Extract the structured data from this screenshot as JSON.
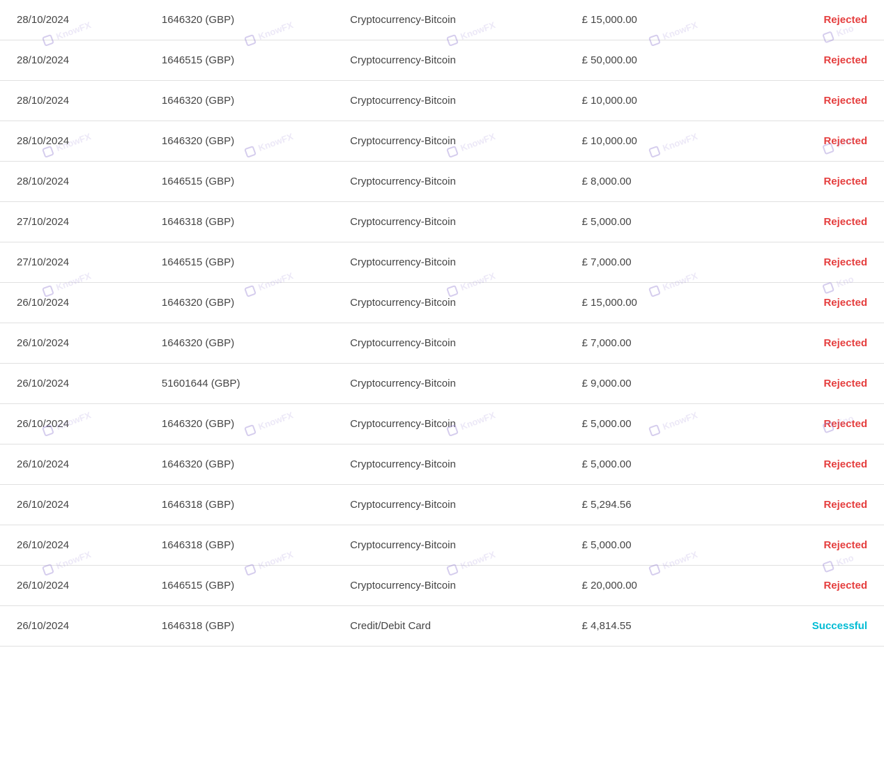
{
  "table": {
    "rows": [
      {
        "date": "28/10/2024",
        "account": "1646320 (GBP)",
        "method": "Cryptocurrency-Bitcoin",
        "amount": "£  15,000.00",
        "status": "Rejected",
        "status_type": "rejected"
      },
      {
        "date": "28/10/2024",
        "account": "1646515 (GBP)",
        "method": "Cryptocurrency-Bitcoin",
        "amount": "£  50,000.00",
        "status": "Rejected",
        "status_type": "rejected"
      },
      {
        "date": "28/10/2024",
        "account": "1646320 (GBP)",
        "method": "Cryptocurrency-Bitcoin",
        "amount": "£  10,000.00",
        "status": "Rejected",
        "status_type": "rejected"
      },
      {
        "date": "28/10/2024",
        "account": "1646320 (GBP)",
        "method": "Cryptocurrency-Bitcoin",
        "amount": "£  10,000.00",
        "status": "Rejected",
        "status_type": "rejected"
      },
      {
        "date": "28/10/2024",
        "account": "1646515 (GBP)",
        "method": "Cryptocurrency-Bitcoin",
        "amount": "£  8,000.00",
        "status": "Rejected",
        "status_type": "rejected"
      },
      {
        "date": "27/10/2024",
        "account": "1646318 (GBP)",
        "method": "Cryptocurrency-Bitcoin",
        "amount": "£  5,000.00",
        "status": "Rejected",
        "status_type": "rejected"
      },
      {
        "date": "27/10/2024",
        "account": "1646515 (GBP)",
        "method": "Cryptocurrency-Bitcoin",
        "amount": "£  7,000.00",
        "status": "Rejected",
        "status_type": "rejected"
      },
      {
        "date": "26/10/2024",
        "account": "1646320 (GBP)",
        "method": "Cryptocurrency-Bitcoin",
        "amount": "£  15,000.00",
        "status": "Rejected",
        "status_type": "rejected"
      },
      {
        "date": "26/10/2024",
        "account": "1646320 (GBP)",
        "method": "Cryptocurrency-Bitcoin",
        "amount": "£  7,000.00",
        "status": "Rejected",
        "status_type": "rejected"
      },
      {
        "date": "26/10/2024",
        "account": "51601644 (GBP)",
        "method": "Cryptocurrency-Bitcoin",
        "amount": "£  9,000.00",
        "status": "Rejected",
        "status_type": "rejected"
      },
      {
        "date": "26/10/2024",
        "account": "1646320 (GBP)",
        "method": "Cryptocurrency-Bitcoin",
        "amount": "£  5,000.00",
        "status": "Rejected",
        "status_type": "rejected"
      },
      {
        "date": "26/10/2024",
        "account": "1646320 (GBP)",
        "method": "Cryptocurrency-Bitcoin",
        "amount": "£  5,000.00",
        "status": "Rejected",
        "status_type": "rejected"
      },
      {
        "date": "26/10/2024",
        "account": "1646318 (GBP)",
        "method": "Cryptocurrency-Bitcoin",
        "amount": "£  5,294.56",
        "status": "Rejected",
        "status_type": "rejected"
      },
      {
        "date": "26/10/2024",
        "account": "1646318 (GBP)",
        "method": "Cryptocurrency-Bitcoin",
        "amount": "£  5,000.00",
        "status": "Rejected",
        "status_type": "rejected"
      },
      {
        "date": "26/10/2024",
        "account": "1646515 (GBP)",
        "method": "Cryptocurrency-Bitcoin",
        "amount": "£  20,000.00",
        "status": "Rejected",
        "status_type": "rejected"
      },
      {
        "date": "26/10/2024",
        "account": "1646318 (GBP)",
        "method": "Credit/Debit Card",
        "amount": "£  4,814.55",
        "status": "Successful",
        "status_type": "successful"
      }
    ]
  }
}
